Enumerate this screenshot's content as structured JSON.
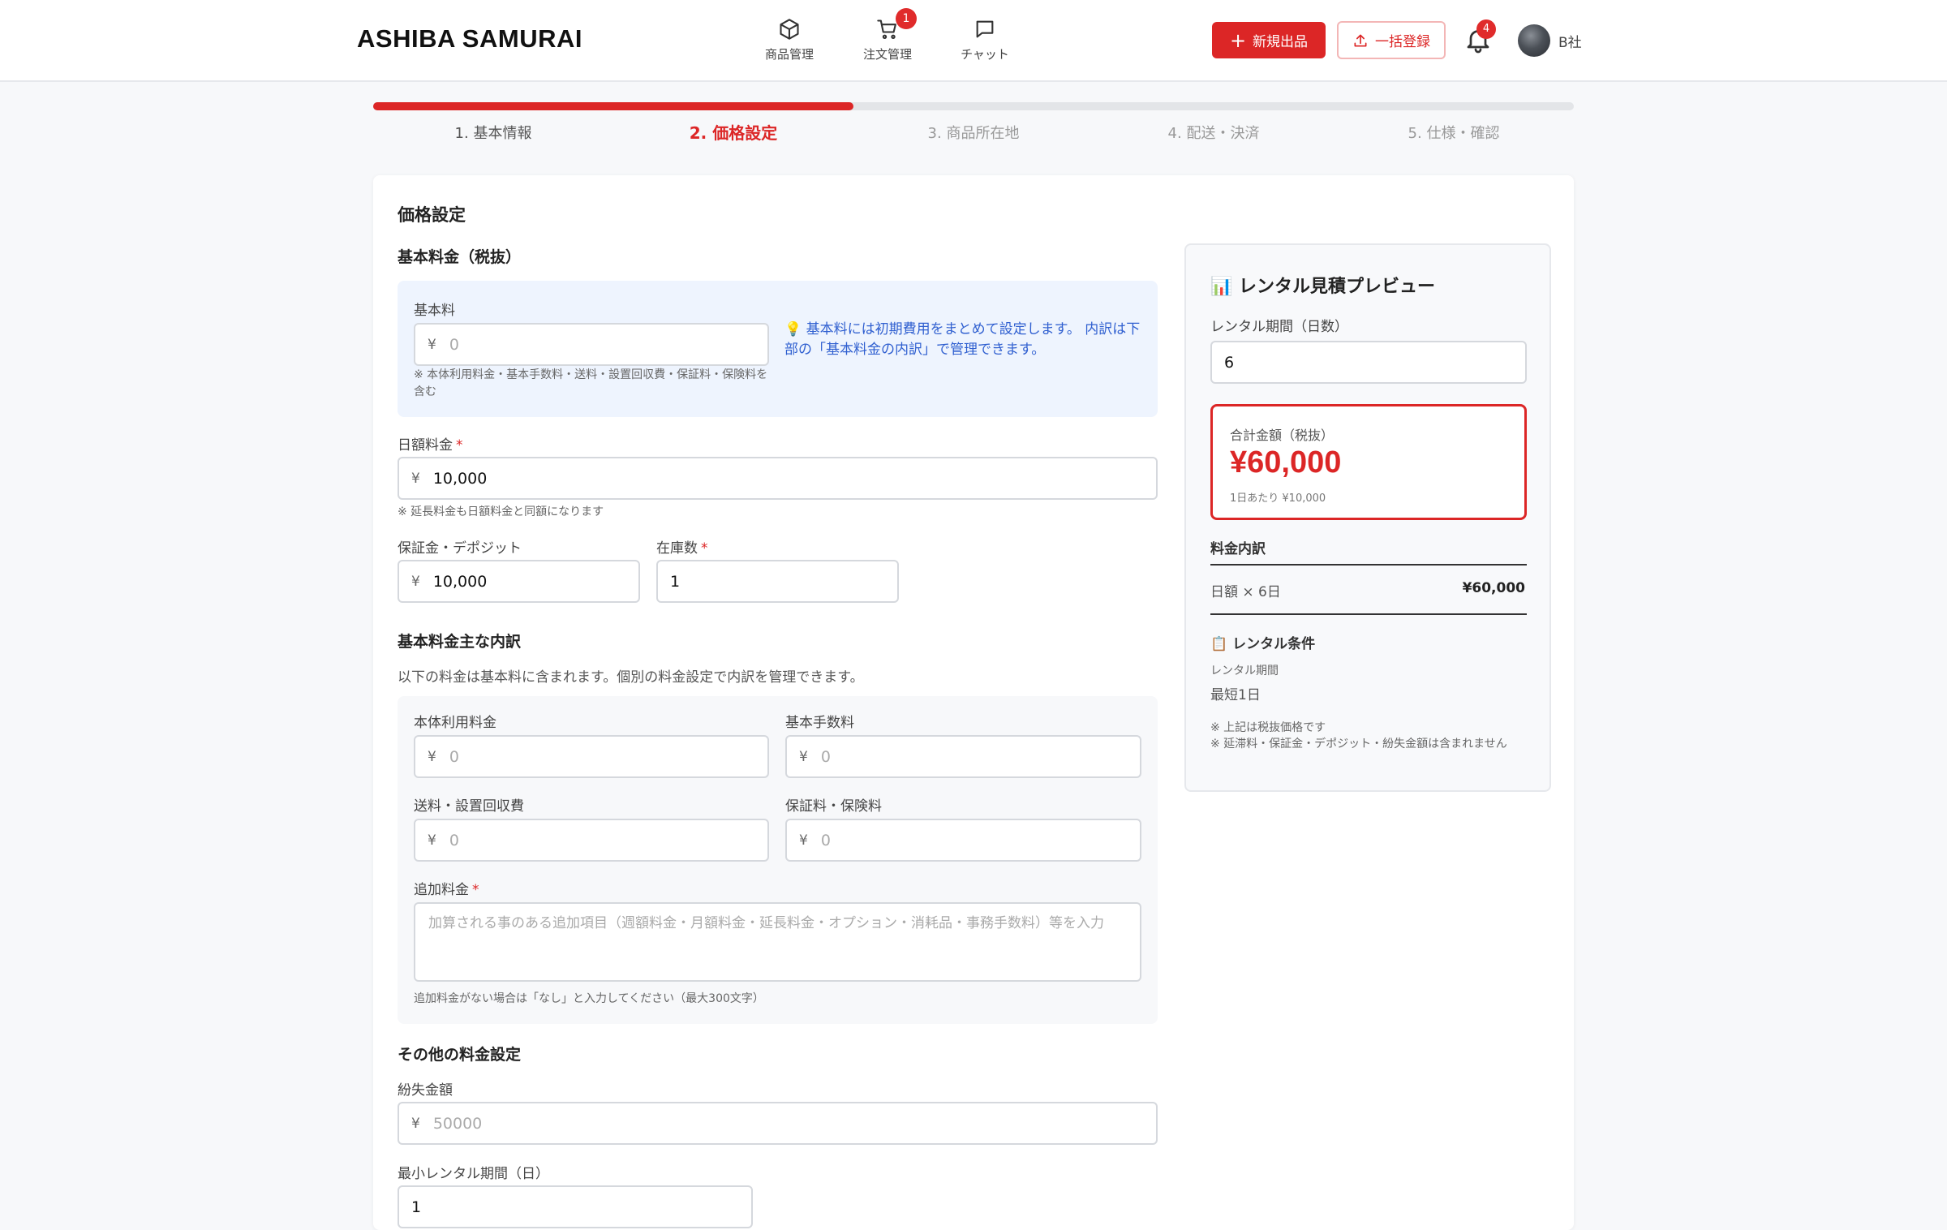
{
  "header": {
    "brand": "ASHIBA SAMURAI",
    "nav": [
      {
        "label": "商品管理",
        "icon": "box-icon"
      },
      {
        "label": "注文管理",
        "icon": "cart-icon",
        "badge": "1"
      },
      {
        "label": "チャット",
        "icon": "chat-icon"
      }
    ],
    "new_listing_label": "新規出品",
    "bulk_register_label": "一括登録",
    "notification_count": "4",
    "user_name": "B社"
  },
  "steps": {
    "progress": 0.4,
    "items": [
      "1. 基本情報",
      "2. 価格設定",
      "3. 商品所在地",
      "4. 配送・決済",
      "5. 仕様・確認"
    ],
    "active_index": 1
  },
  "form": {
    "section_title": "価格設定",
    "base_fee_heading": "基本料金（税抜）",
    "base_fee_label": "基本料",
    "base_fee_placeholder": "0",
    "base_fee_note": "※ 本体利用料金・基本手数料・送料・設置回収費・保証料・保険料を含む",
    "base_fee_tip": "💡 基本料には初期費用をまとめて設定します。 内訳は下部の「基本料金の内訳」で管理できます。",
    "daily_fee_label": "日額料金",
    "daily_fee_value": "10,000",
    "daily_fee_note": "※ 延長料金も日額料金と同額になります",
    "deposit_label": "保証金・デポジット",
    "deposit_value": "10,000",
    "stock_label": "在庫数",
    "stock_value": "1",
    "breakdown_heading": "基本料金主な内訳",
    "breakdown_desc": "以下の料金は基本料に含まれます。個別の料金設定で内訳を管理できます。",
    "body_fee_label": "本体利用料金",
    "basic_commission_label": "基本手数料",
    "shipping_label": "送料・設置回収費",
    "insurance_label": "保証料・保険料",
    "breakdown_placeholder": "0",
    "additional_label": "追加料金",
    "additional_placeholder": "加算される事のある追加項目（週額料金・月額料金・延長料金・オプション・消耗品・事務手数料）等を入力",
    "additional_note": "追加料金がない場合は「なし」と入力してください（最大300文字）",
    "other_heading": "その他の料金設定",
    "loss_label": "紛失金額",
    "loss_placeholder": "50000",
    "min_period_label": "最小レンタル期間（日）",
    "min_period_value": "1",
    "currency": "¥",
    "required_mark": "*"
  },
  "preview": {
    "title": "📊 レンタル見積プレビュー",
    "period_label": "レンタル期間（日数）",
    "period_value": "6",
    "total_label": "合計金額（税抜）",
    "total_amount": "¥60,000",
    "per_day": "1日あたり ¥10,000",
    "breakdown_heading": "料金内訳",
    "row_label": "日額 × 6日",
    "row_value": "¥60,000",
    "conditions_heading": "📋 レンタル条件",
    "conditions_period_label": "レンタル期間",
    "conditions_period_value": "最短1日",
    "note1": "※ 上記は税抜価格です",
    "note2": "※ 延滞料・保証金・デポジット・紛失金額は含まれません"
  },
  "colors": {
    "accent": "#dc2626",
    "tip": "#2f5fd0",
    "info_bg": "#eef4fe"
  }
}
